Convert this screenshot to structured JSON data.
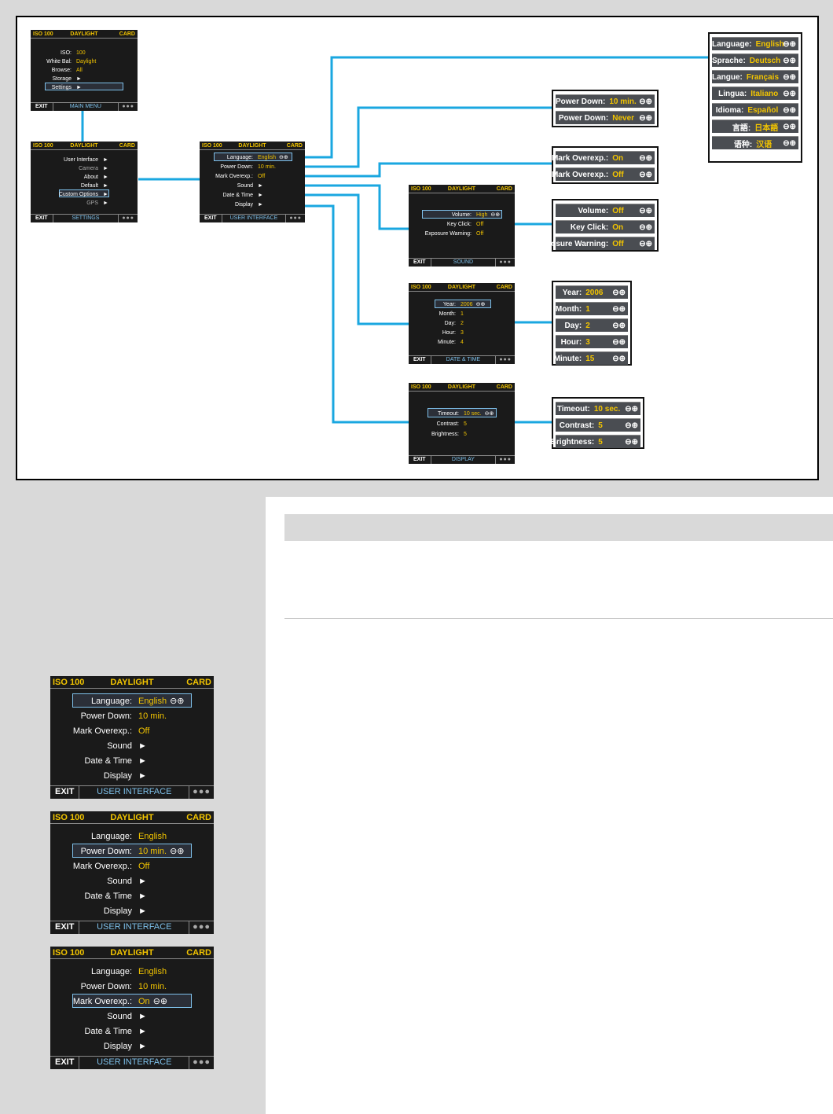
{
  "main_menu": {
    "iso": "ISO 100",
    "mode": "DAYLIGHT",
    "media": "CARD",
    "rows": [
      {
        "label": "ISO:",
        "value": "100"
      },
      {
        "label": "White Bal:",
        "value": "Daylight"
      },
      {
        "label": "Browse:",
        "value": "All"
      },
      {
        "label": "Storage",
        "value": "►"
      },
      {
        "label": "Settings",
        "value": "►"
      }
    ],
    "exit": "EXIT",
    "footer": "MAIN MENU",
    "dots": "●●●"
  },
  "settings": {
    "iso": "ISO 100",
    "mode": "DAYLIGHT",
    "media": "CARD",
    "rows": [
      {
        "label": "User Interface",
        "value": "►"
      },
      {
        "label": "Camera",
        "value": "►"
      },
      {
        "label": "About",
        "value": "►"
      },
      {
        "label": "Default",
        "value": "►"
      },
      {
        "label": "Custom Options",
        "value": "►"
      },
      {
        "label": "GPS",
        "value": "►"
      }
    ],
    "exit": "EXIT",
    "footer": "SETTINGS",
    "dots": "●●●"
  },
  "user_interface": {
    "iso": "ISO 100",
    "mode": "DAYLIGHT",
    "media": "CARD",
    "rows": [
      {
        "label": "Language:",
        "value": "English"
      },
      {
        "label": "Power Down:",
        "value": "10 min."
      },
      {
        "label": "Mark Overexp.:",
        "value": "Off"
      },
      {
        "label": "Sound",
        "value": "►"
      },
      {
        "label": "Date & Time",
        "value": "►"
      },
      {
        "label": "Display",
        "value": "►"
      }
    ],
    "exit": "EXIT",
    "footer": "USER INTERFACE",
    "dots": "●●●"
  },
  "sound": {
    "iso": "ISO 100",
    "mode": "DAYLIGHT",
    "media": "CARD",
    "rows": [
      {
        "label": "Volume:",
        "value": "High"
      },
      {
        "label": "Key Click:",
        "value": "Off"
      },
      {
        "label": "Exposure Warning:",
        "value": "Off"
      }
    ],
    "exit": "EXIT",
    "footer": "SOUND",
    "dots": "●●●"
  },
  "date_time": {
    "iso": "ISO 100",
    "mode": "DAYLIGHT",
    "media": "CARD",
    "rows": [
      {
        "label": "Year:",
        "value": "2006"
      },
      {
        "label": "Month:",
        "value": "1"
      },
      {
        "label": "Day:",
        "value": "2"
      },
      {
        "label": "Hour:",
        "value": "3"
      },
      {
        "label": "Minute:",
        "value": "4"
      }
    ],
    "exit": "EXIT",
    "footer": "DATE & TIME",
    "dots": "●●●"
  },
  "display": {
    "iso": "ISO 100",
    "mode": "DAYLIGHT",
    "media": "CARD",
    "rows": [
      {
        "label": "Timeout:",
        "value": "10 sec."
      },
      {
        "label": "Contrast:",
        "value": "5"
      },
      {
        "label": "Brightness:",
        "value": "5"
      }
    ],
    "exit": "EXIT",
    "footer": "DISPLAY",
    "dots": "●●●"
  },
  "language_options": [
    {
      "label": "Language:",
      "value": "English"
    },
    {
      "label": "Sprache:",
      "value": "Deutsch"
    },
    {
      "label": "Langue:",
      "value": "Français"
    },
    {
      "label": "Lingua:",
      "value": "Italiano"
    },
    {
      "label": "Idioma:",
      "value": "Español"
    },
    {
      "label": "言語:",
      "value": "日本語"
    },
    {
      "label": "语种:",
      "value": "汉语"
    }
  ],
  "power_options": [
    {
      "label": "Power Down:",
      "value": "10 min."
    },
    {
      "label": "Power Down:",
      "value": "Never"
    }
  ],
  "overexp_options": [
    {
      "label": "Mark Overexp.:",
      "value": "On"
    },
    {
      "label": "Mark Overexp.:",
      "value": "Off"
    }
  ],
  "sound_options": [
    {
      "label": "Volume:",
      "value": "Off"
    },
    {
      "label": "Key Click:",
      "value": "On"
    },
    {
      "label": "Exposure Warning:",
      "value": "Off"
    }
  ],
  "datetime_options": [
    {
      "label": "Year:",
      "value": "2006"
    },
    {
      "label": "Month:",
      "value": "1"
    },
    {
      "label": "Day:",
      "value": "2"
    },
    {
      "label": "Hour:",
      "value": "3"
    },
    {
      "label": "Minute:",
      "value": "15"
    }
  ],
  "display_options": [
    {
      "label": "Timeout:",
      "value": "10 sec."
    },
    {
      "label": "Contrast:",
      "value": "5"
    },
    {
      "label": "Brightness:",
      "value": "5"
    }
  ],
  "plus_minus": "⊖⊕",
  "side_screens": [
    {
      "iso": "ISO 100",
      "mode": "DAYLIGHT",
      "media": "CARD",
      "rows": [
        {
          "label": "Language:",
          "value": "English"
        },
        {
          "label": "Power Down:",
          "value": "10 min."
        },
        {
          "label": "Mark Overexp.:",
          "value": "Off"
        },
        {
          "label": "Sound",
          "value": "►"
        },
        {
          "label": "Date & Time",
          "value": "►"
        },
        {
          "label": "Display",
          "value": "►"
        }
      ],
      "exit": "EXIT",
      "footer": "USER INTERFACE",
      "dots": "●●●"
    },
    {
      "iso": "ISO 100",
      "mode": "DAYLIGHT",
      "media": "CARD",
      "rows": [
        {
          "label": "Language:",
          "value": "English"
        },
        {
          "label": "Power Down:",
          "value": "10 min."
        },
        {
          "label": "Mark Overexp.:",
          "value": "Off"
        },
        {
          "label": "Sound",
          "value": "►"
        },
        {
          "label": "Date & Time",
          "value": "►"
        },
        {
          "label": "Display",
          "value": "►"
        }
      ],
      "exit": "EXIT",
      "footer": "USER INTERFACE",
      "dots": "●●●"
    },
    {
      "iso": "ISO 100",
      "mode": "DAYLIGHT",
      "media": "CARD",
      "rows": [
        {
          "label": "Language:",
          "value": "English"
        },
        {
          "label": "Power Down:",
          "value": "10 min."
        },
        {
          "label": "Mark Overexp.:",
          "value": "On"
        },
        {
          "label": "Sound",
          "value": "►"
        },
        {
          "label": "Date & Time",
          "value": "►"
        },
        {
          "label": "Display",
          "value": "►"
        }
      ],
      "exit": "EXIT",
      "footer": "USER INTERFACE",
      "dots": "●●●"
    }
  ],
  "colors": {
    "connector": "#1aa7e0",
    "value_text": "#f2c400",
    "screen_bg": "#1a1a1a",
    "highlight": "#7ec0ea"
  }
}
